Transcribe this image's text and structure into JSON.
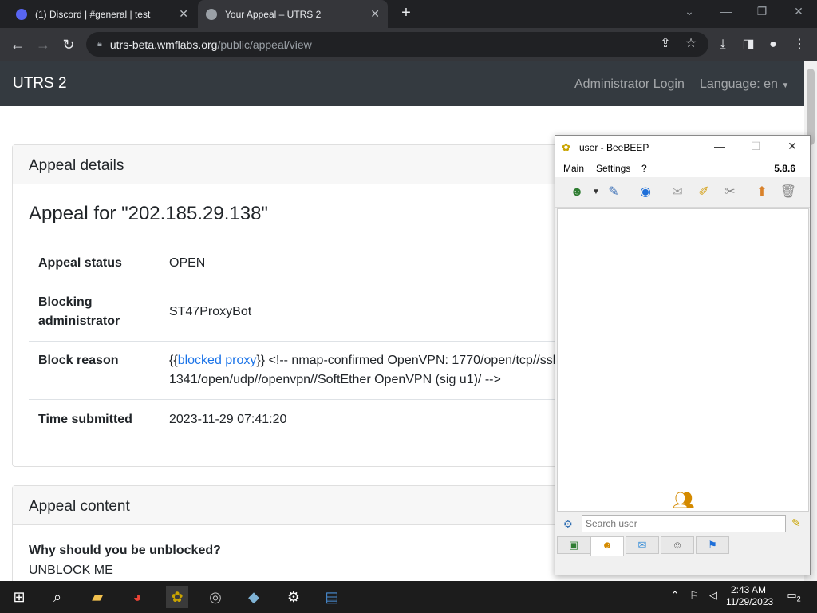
{
  "browser": {
    "tabs": [
      {
        "label": "(1) Discord | #general | test"
      },
      {
        "label": "Your Appeal – UTRS 2"
      }
    ],
    "url_host": "utrs-beta.wmflabs.org",
    "url_path": "/public/appeal/view"
  },
  "page": {
    "brand": "UTRS 2",
    "admin_login": "Administrator Login",
    "language": "Language: en",
    "details_header": "Appeal details",
    "appeal_title": "Appeal for \"202.185.29.138\"",
    "rows": [
      {
        "label": "Appeal status",
        "value": "OPEN"
      },
      {
        "label1": "Blocking",
        "label2": "administrator",
        "value": "ST47ProxyBot"
      },
      {
        "label": "Block reason",
        "prefix": "{{",
        "link": "blocked proxy",
        "suffix": "}} <!-- nmap-confirmed OpenVPN: 1770/open/tcp//ssl|openvpn//SoftEther OpenVPN (sig u1)/ ",
        "line2": "1341/open/udp//openvpn//SoftEther OpenVPN (sig u1)/ -->"
      },
      {
        "label": "Time submitted",
        "value": "2023-11-29 07:41:20"
      }
    ],
    "content_header": "Appeal content",
    "why_label": "Why should you be unblocked?",
    "why_value": "UNBLOCK ME"
  },
  "beebeep": {
    "title": "user - BeeBEEP",
    "menu": [
      "Main",
      "Settings",
      "?"
    ],
    "version": "5.8.6",
    "search_placeholder": "Search user"
  },
  "taskbar": {
    "time": "2:43 AM",
    "date": "11/29/2023",
    "notification_count": "2"
  }
}
